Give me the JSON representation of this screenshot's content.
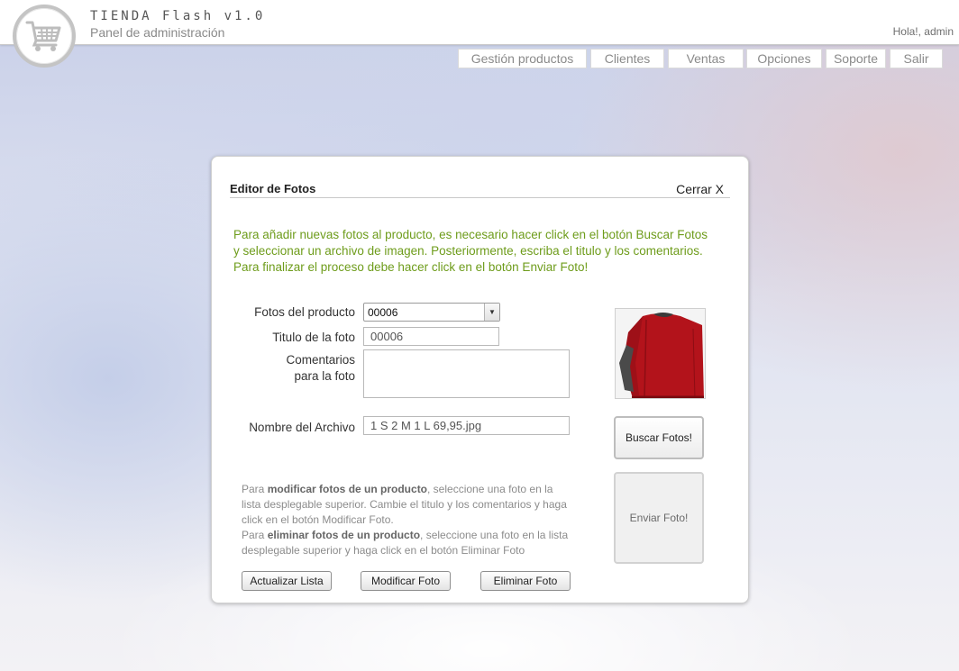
{
  "header": {
    "app_title": "TIENDA Flash v1.0",
    "subtitle": "Panel de administración",
    "greeting": "Hola!, admin",
    "logo_icon": "shopping-cart-icon"
  },
  "nav": {
    "items": [
      {
        "label": "Gestión productos"
      },
      {
        "label": "Clientes"
      },
      {
        "label": "Ventas"
      },
      {
        "label": "Opciones"
      },
      {
        "label": "Soporte"
      },
      {
        "label": "Salir"
      }
    ]
  },
  "editor": {
    "title": "Editor de Fotos",
    "close_label": "Cerrar X",
    "instructions": [
      "Para añadir nuevas fotos al producto, es necesario hacer click en el botón Buscar Fotos",
      "y seleccionar un archivo de imagen. Posteriormente, escriba el titulo y los comentarios.",
      "Para finalizar el proceso debe hacer click en el botón Enviar Foto!"
    ],
    "fields": {
      "photos_label": "Fotos del producto",
      "photos_selected": "00006",
      "title_label": "Titulo de la foto",
      "title_value": "00006",
      "comments_label_line1": "Comentarios",
      "comments_label_line2": "para la foto",
      "comments_value": "",
      "filename_label": "Nombre del Archivo",
      "filename_value": "1 S 2 M 1 L 69,95.jpg"
    },
    "buttons": {
      "browse": "Buscar Fotos!",
      "send": "Enviar Foto!",
      "refresh": "Actualizar Lista",
      "modify": "Modificar Foto",
      "delete": "Eliminar Foto"
    },
    "help": {
      "p1_pre": "Para ",
      "p1_bold": "modificar fotos de un producto",
      "p1_post": ", seleccione una foto en la",
      "p1_line2": "lista desplegable superior. Cambie el titulo y los comentarios y haga",
      "p1_line3": "click en el botón Modificar Foto.",
      "p2_pre": "Para ",
      "p2_bold": "eliminar fotos de un producto",
      "p2_post": ", seleccione una foto en la lista",
      "p2_line2": "desplegable superior y haga click en el botón Eliminar Foto"
    },
    "photo_icon": "red-sweater-photo"
  },
  "colors": {
    "instruction_text": "#6e9c1b",
    "sweater_red": "#b3131b",
    "sweater_gray": "#4a4a4a"
  }
}
